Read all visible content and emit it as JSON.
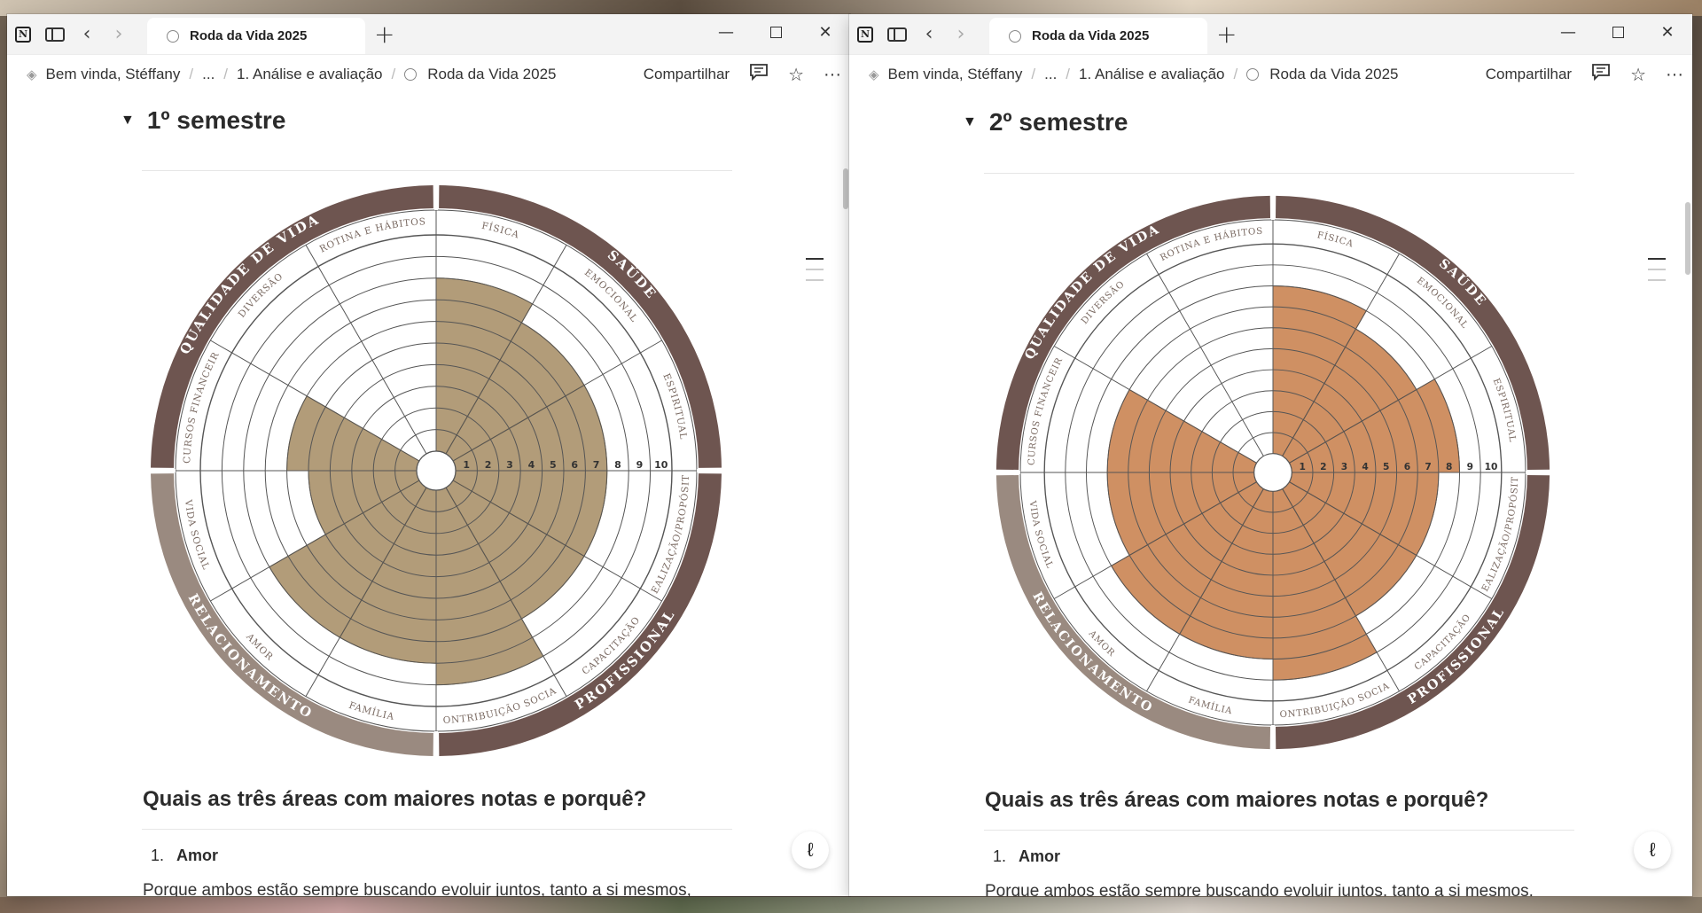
{
  "windows": [
    {
      "id": "left",
      "tab_title": "Roda da Vida 2025",
      "breadcrumb": [
        "Bem vinda, Stéffany",
        "...",
        "1. Análise e avaliação",
        "Roda da Vida 2025"
      ],
      "share_label": "Compartilhar",
      "section_title": "1º semestre",
      "fill_color": "#b29c79",
      "fill_line": "#8b6e3e",
      "area_scores": [
        8,
        7,
        7,
        7,
        7,
        9,
        8,
        8,
        5,
        6
      ],
      "question": "Quais as três áreas com maiores notas e porquê?",
      "list_number": "1.",
      "list_item": "Amor",
      "paragraph": "Porque ambos estão sempre buscando evoluir juntos, tanto a si mesmos,"
    },
    {
      "id": "right",
      "tab_title": "Roda da Vida 2025",
      "breadcrumb": [
        "Bem vinda, Stéffany",
        "...",
        "1. Análise e avaliação",
        "Roda da Vida 2025"
      ],
      "share_label": "Compartilhar",
      "section_title": "2º semestre",
      "fill_color": "#cf9063",
      "fill_line": "#8a5530",
      "area_scores": [
        8,
        7,
        8,
        7,
        7,
        9,
        8,
        8,
        7,
        7
      ],
      "question": "Quais as três áreas com maiores notas e porquê?",
      "list_number": "1.",
      "list_item": "Amor",
      "paragraph": "Porque ambos estão sempre buscando evoluir juntos, tanto a si mesmos,"
    }
  ],
  "wheel": {
    "categories": [
      {
        "label": "SAÚDE",
        "color": "#6e5550"
      },
      {
        "label": "PROFISSIONAL",
        "color": "#6e5550"
      },
      {
        "label": "RELACIONAMENTO",
        "color": "#9a8a80"
      },
      {
        "label": "QUALIDADE DE VIDA",
        "color": "#6e5550"
      }
    ],
    "areas": [
      "FÍSICA",
      "EMOCIONAL",
      "ESPIRITUAL",
      "REALIZAÇÃO/PROPÓSITO",
      "CAPACITAÇÃO",
      "CONTRIBUIÇÃO SOCIAL",
      "FAMÍLIA",
      "AMOR",
      "VIDA SOCIAL",
      "RECURSOS FINANCEIROS",
      "DIVERSÃO",
      "ROTINA E HÁBITOS"
    ],
    "scale": [
      "1",
      "2",
      "3",
      "4",
      "5",
      "6",
      "7",
      "8",
      "9",
      "10"
    ],
    "area_band_color_dark": "#6e5550",
    "area_band_color_light": "#9a8a80"
  },
  "icons": {
    "notion": "N",
    "sidebar": "sidebar-icon",
    "back": "‹",
    "forward": "›",
    "new_tab": "+",
    "minimize": "—",
    "close": "✕",
    "comment": "💬",
    "star": "☆",
    "more": "···",
    "gem": "◈",
    "fab": "ℓ"
  }
}
